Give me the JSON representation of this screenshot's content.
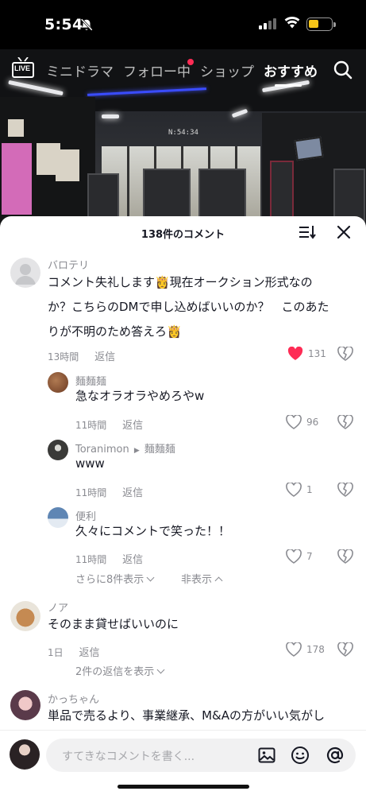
{
  "status_bar": {
    "time": "5:54"
  },
  "top_nav": {
    "live_label": "LIVE",
    "tabs": [
      {
        "label": "ミニドラマ"
      },
      {
        "label": "フォロー中"
      },
      {
        "label": "ショップ"
      },
      {
        "label": "おすすめ"
      }
    ]
  },
  "comments_sheet": {
    "title": "138件のコメント",
    "comments": [
      {
        "username": "バロテリ",
        "text_lines": [
          "コメント失礼します👸現在オークション形式なの",
          "か？こちらのDMで申し込めばいいのか？　このあた",
          "りが不明のため答えろ👸"
        ],
        "time": "13時間",
        "reply_label": "返信",
        "likes": "131"
      },
      {
        "username": "麵麵麺",
        "text": "急なオラオラやめろやw",
        "time": "11時間",
        "reply_label": "返信",
        "likes": "96"
      },
      {
        "username": "Toranimon",
        "reply_to": "麵麵麺",
        "text": "www",
        "time": "11時間",
        "reply_label": "返信",
        "likes": "1"
      },
      {
        "username": "便利",
        "text": "久々にコメントで笑った！！",
        "time": "11時間",
        "reply_label": "返信",
        "likes": "7",
        "more_replies": "さらに8件表示",
        "hide_label": "非表示"
      },
      {
        "username": "ノア",
        "text": "そのまま貸せばいいのに",
        "time": "1日",
        "reply_label": "返信",
        "likes": "178",
        "show_replies": "2件の返信を表示"
      },
      {
        "username": "かっちゃん",
        "text": "単品で売るより、事業継承、M&Aの方がいい気がし"
      }
    ]
  },
  "input_bar": {
    "placeholder": "すてきなコメントを書く..."
  },
  "colors": {
    "like_active": "#fe2c55",
    "text": "#161823",
    "muted": "#8a8b91"
  }
}
